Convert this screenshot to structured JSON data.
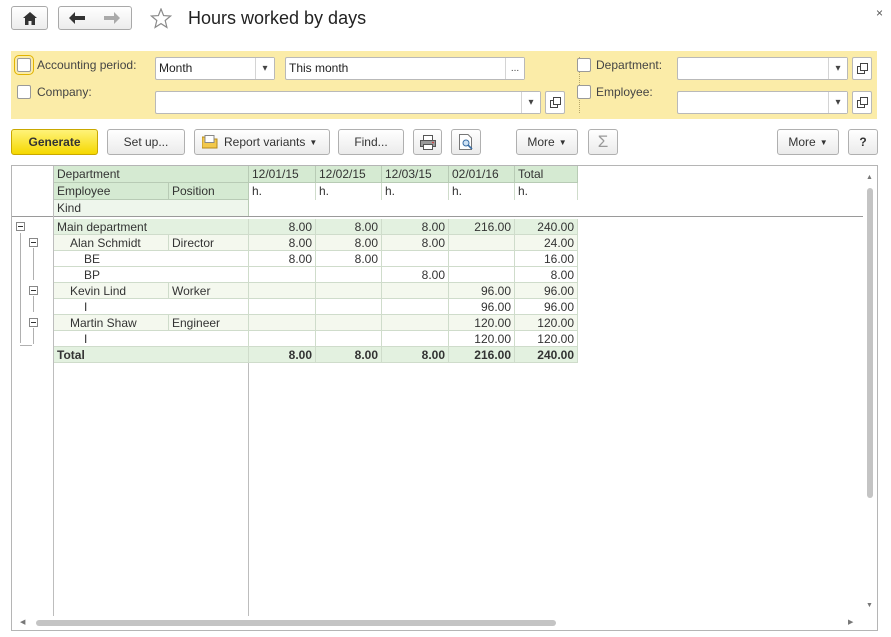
{
  "header": {
    "title": "Hours worked by days",
    "icons": {
      "home": "home-icon",
      "back": "arrow-left-icon",
      "forward": "arrow-right-icon",
      "favorite": "star-icon",
      "close": "close-icon"
    },
    "close_glyph": "×"
  },
  "filters": {
    "accounting_period_label": "Accounting period:",
    "period_type_value": "Month",
    "period_value": "This month",
    "period_ellipsis": "...",
    "company_label": "Company:",
    "company_value": "",
    "department_label": "Department:",
    "department_value": "",
    "employee_label": "Employee:",
    "employee_value": ""
  },
  "toolbar": {
    "generate": "Generate",
    "setup": "Set up...",
    "report_variants": "Report variants",
    "find": "Find...",
    "more_left": "More",
    "more_right": "More",
    "help": "?"
  },
  "report": {
    "header_labels": {
      "department": "Department",
      "employee": "Employee",
      "position": "Position",
      "kind": "Kind",
      "unit": "h."
    },
    "date_columns": [
      "12/01/15",
      "12/02/15",
      "12/03/15",
      "02/01/16",
      "Total"
    ],
    "rows": [
      {
        "type": "group",
        "label": "Main department",
        "position": "",
        "values": [
          "8.00",
          "8.00",
          "8.00",
          "216.00",
          "240.00"
        ]
      },
      {
        "type": "employee",
        "label": "Alan Schmidt",
        "position": "Director",
        "values": [
          "8.00",
          "8.00",
          "8.00",
          "",
          "24.00"
        ]
      },
      {
        "type": "kind",
        "label": "BE",
        "position": "",
        "values": [
          "8.00",
          "8.00",
          "",
          "",
          "16.00"
        ]
      },
      {
        "type": "kind",
        "label": "BP",
        "position": "",
        "values": [
          "",
          "",
          "8.00",
          "",
          "8.00"
        ]
      },
      {
        "type": "employee",
        "label": "Kevin Lind",
        "position": "Worker",
        "values": [
          "",
          "",
          "",
          "96.00",
          "96.00"
        ]
      },
      {
        "type": "kind",
        "label": "I",
        "position": "",
        "values": [
          "",
          "",
          "",
          "96.00",
          "96.00"
        ]
      },
      {
        "type": "employee",
        "label": "Martin Shaw",
        "position": "Engineer",
        "values": [
          "",
          "",
          "",
          "120.00",
          "120.00"
        ]
      },
      {
        "type": "kind",
        "label": "I",
        "position": "",
        "values": [
          "",
          "",
          "",
          "120.00",
          "120.00"
        ]
      },
      {
        "type": "total",
        "label": "Total",
        "position": "",
        "values": [
          "8.00",
          "8.00",
          "8.00",
          "216.00",
          "240.00"
        ]
      }
    ]
  },
  "colors": {
    "filter_panel_bg": "#fbeca8",
    "primary_button": "#f5d800",
    "header_green": "#d5ead2",
    "group_row_green": "#e3f1e0",
    "employee_row_bg": "#f4f8ee"
  }
}
